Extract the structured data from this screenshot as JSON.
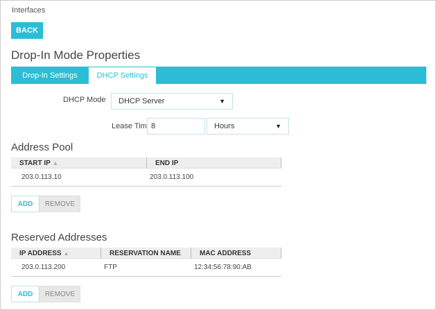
{
  "breadcrumb": "Interfaces",
  "back_label": "BACK",
  "title": "Drop-In Mode Properties",
  "tabs": [
    {
      "label": "Drop-In Settings"
    },
    {
      "label": "DHCP Settings"
    }
  ],
  "dhcp_mode": {
    "label": "DHCP Mode",
    "value": "DHCP Server"
  },
  "lease_time": {
    "label": "Lease Time",
    "value": "8",
    "unit": "Hours"
  },
  "address_pool": {
    "heading": "Address Pool",
    "columns": [
      "START IP",
      "END IP"
    ],
    "rows": [
      [
        "203.0.113.10",
        "203.0.113.100"
      ]
    ],
    "add": "ADD",
    "remove": "REMOVE"
  },
  "reserved": {
    "heading": "Reserved Addresses",
    "columns": [
      "IP ADDRESS",
      "RESERVATION NAME",
      "MAC ADDRESS"
    ],
    "rows": [
      [
        "203.0.113.200",
        "FTP",
        "12:34:56:78:90:AB"
      ]
    ],
    "add": "ADD",
    "remove": "REMOVE"
  },
  "colors": {
    "accent": "#2bbdd6"
  }
}
